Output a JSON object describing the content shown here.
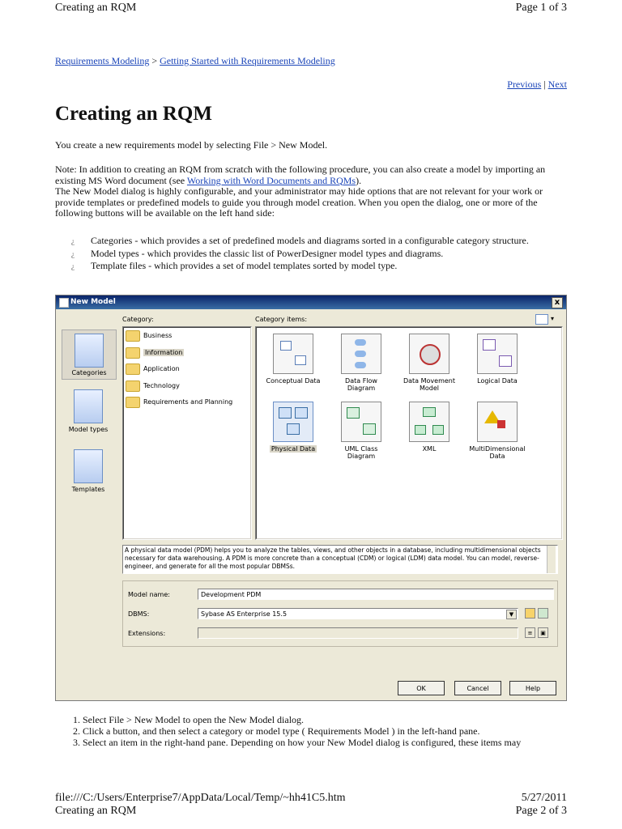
{
  "header": {
    "doc_title": "Creating an RQM",
    "page_label": "Page 1 of 3"
  },
  "breadcrumb": {
    "parent": "Requirements Modeling",
    "separator": ">",
    "current": "Getting Started with Requirements Modeling"
  },
  "pager": {
    "previous": "Previous",
    "separator": "|",
    "next": "Next"
  },
  "page_title": "Creating an RQM",
  "intro": "You create a new requirements model by selecting File > New Model.",
  "note": {
    "before_link": "Note: In addition to creating an RQM from scratch with the following procedure, you can also create a model by importing an existing MS Word document (see ",
    "link": "Working with Word Documents and RQMs",
    "after_link": ").",
    "line2": "The New Model dialog is highly configurable, and your administrator may hide options that are not relevant for your work or provide templates or predefined models to guide you through model creation. When you open the dialog, one or more of the following buttons will be available on the left hand side:"
  },
  "bullets": [
    "Categories - which provides a set of predefined models and diagrams sorted in a configurable category structure.",
    "Model types - which provides the classic list of PowerDesigner model types and diagrams.",
    "Template files - which provides a set of model templates sorted by model type."
  ],
  "dialog": {
    "title": "New Model",
    "close": "x",
    "category_label": "Category:",
    "category_items_label": "Category items:",
    "left_buttons": [
      "Categories",
      "Model types",
      "Templates"
    ],
    "categories": [
      "Business",
      "Information",
      "Application",
      "Technology",
      "Requirements and Planning"
    ],
    "items": [
      {
        "label": "Conceptual Data",
        "icon": "conceptual-data-icon"
      },
      {
        "label": "Data Flow Diagram",
        "icon": "data-flow-icon"
      },
      {
        "label": "Data Movement Model",
        "icon": "data-movement-icon"
      },
      {
        "label": "Logical Data",
        "icon": "logical-data-icon"
      },
      {
        "label": "Physical Data",
        "icon": "physical-data-icon"
      },
      {
        "label": "UML Class Diagram",
        "icon": "uml-class-icon"
      },
      {
        "label": "XML",
        "icon": "xml-icon"
      },
      {
        "label": "MultiDimensional Data",
        "icon": "multidimensional-icon"
      }
    ],
    "description": "A physical data model (PDM) helps you to analyze the tables, views, and other objects in a database, including multidimensional objects necessary for data warehousing. A PDM is more concrete than a conceptual (CDM) or logical (LDM) data model. You can model, reverse-engineer, and generate for all the most popular DBMSs.",
    "model_name_label": "Model name:",
    "model_name_value": "Development PDM",
    "dbms_label": "DBMS:",
    "dbms_value": "Sybase AS Enterprise 15.5",
    "extensions_label": "Extensions:",
    "ok": "OK",
    "cancel": "Cancel",
    "help": "Help"
  },
  "steps": [
    "Select File > New Model to open the New Model dialog.",
    "Click a button, and then select a category or model type ( Requirements Model ) in the left-hand pane.",
    "Select an item in the right-hand pane. Depending on how your New Model dialog is configured, these items may"
  ],
  "footer": {
    "path": "file:///C:/Users/Enterprise7/AppData/Local/Temp/~hh41C5.htm",
    "date": "5/27/2011",
    "doc_title": "Creating an RQM",
    "page_label": "Page 2 of 3"
  }
}
